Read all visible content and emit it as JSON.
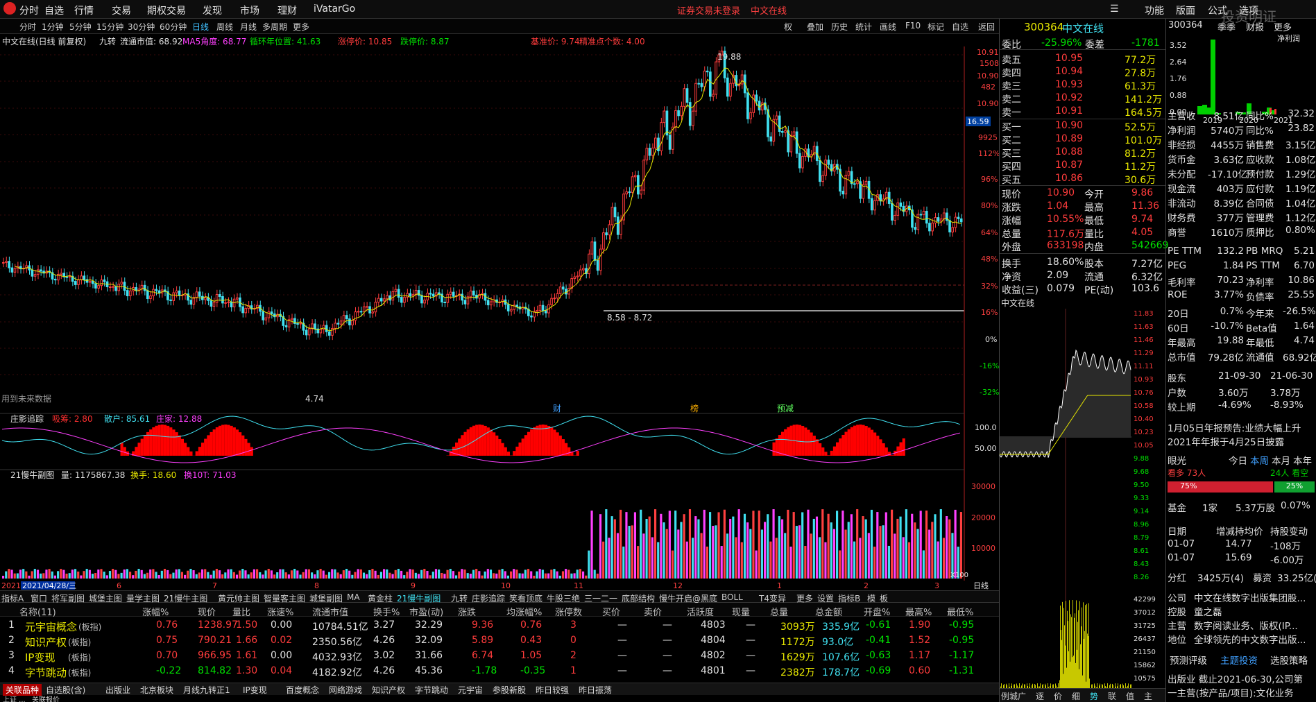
{
  "menu": {
    "items": [
      "分时",
      "自选",
      "行情",
      "交易",
      "期权交易",
      "发现",
      "市场",
      "理财",
      "iVatarGo"
    ],
    "notice_login": "证券交易未登录",
    "notice_stock": "中文在线",
    "right_items": [
      "功能",
      "版面",
      "公式",
      "选项"
    ],
    "watermark": "投资明证"
  },
  "periods": {
    "items": [
      "分时",
      "1分钟",
      "5分钟",
      "15分钟",
      "30分钟",
      "60分钟",
      "日线",
      "周线",
      "月线",
      "多周期",
      "更多"
    ],
    "active": "日线",
    "tools": [
      "权",
      "叠加",
      "历史",
      "统计",
      "画线",
      "F10",
      "标记",
      "自选",
      "返回"
    ]
  },
  "main_chart": {
    "title": "中文在线(日线 前复权)",
    "subtitle": "九转",
    "float_mv": "流通市值: 68.92",
    "ma_angle": "MA5角度: 68.77",
    "cycle": "循环年位置: 41.63",
    "limit_up": "涨停价: 10.85",
    "limit_down": "跌停价: 8.87",
    "base_price": "基准价: 9.74",
    "precision": "精准点个数: 4.00",
    "peak_label": "19.88",
    "low_label": "4.74",
    "range_label": "8.58 - 8.72",
    "bottom_note": "用到未来数据",
    "markers": [
      "财",
      "榜",
      "预减"
    ],
    "axis_labels": [
      "10.91",
      "1508",
      "10.90",
      "482",
      "10.90",
      "16.59",
      "9925",
      "112%",
      "96%",
      "80%",
      "64%",
      "48%",
      "32%",
      "16%",
      "0%",
      "-16%",
      "-32%"
    ]
  },
  "indicator1": {
    "title": "庄影追踪",
    "a": "吸筹: 2.80",
    "b": "散户: 85.61",
    "c": "庄家: 12.88",
    "axis": [
      "100.0",
      "50.00"
    ]
  },
  "indicator2": {
    "title": "21慢牛副图",
    "vol": "量: 1175867.38",
    "turnover": "换手: 18.60",
    "turnover10": "换10T: 71.03",
    "axis": [
      "30000",
      "20000",
      "10000",
      "X100"
    ]
  },
  "timeline": {
    "start": "2021",
    "date": "2021/04/28/三",
    "months": [
      "6",
      "7",
      "8",
      "9",
      "10",
      "11",
      "12",
      "1",
      "2",
      "3"
    ],
    "right": "日线"
  },
  "formula_tabs": [
    "指标A",
    "窗口",
    "将军副图",
    "城堡主图",
    "量学主图",
    "21慢牛主图",
    "黄元帅主图",
    "智量客主图",
    "城堡副图",
    "MA",
    "黄金柱",
    "21慢牛副图",
    "九转",
    "庄影追踪",
    "笑看顶底",
    "牛股三绝",
    "三一二一",
    "底部结构",
    "慢牛开启@黑底",
    "BOLL",
    "T4变异",
    "更多",
    "设置",
    "指标B",
    "模",
    "板"
  ],
  "table": {
    "headers": [
      "名称(11)",
      "涨幅%",
      "现价",
      "量比",
      "涨速%",
      "流通市值",
      "换手%",
      "市盈(动)",
      "涨跌",
      "均涨幅%",
      "涨停数",
      "买价",
      "卖价",
      "活跃度",
      "现量",
      "总量",
      "总金额",
      "开盘%",
      "最高%",
      "最低%"
    ],
    "rows": [
      {
        "idx": "1",
        "name": "元宇宙概念",
        "tag": "(板指)",
        "cells": [
          "0.76",
          "1238.97",
          "1.50",
          "0.00",
          "10784.51亿",
          "3.27",
          "32.29",
          "9.36",
          "0.76",
          "3",
          "—",
          "—",
          "4803",
          "—",
          "3093万",
          "335.9亿",
          "-0.61",
          "1.90",
          "-0.95"
        ]
      },
      {
        "idx": "2",
        "name": "知识产权",
        "tag": "(板指)",
        "cells": [
          "0.75",
          "790.21",
          "1.66",
          "0.02",
          "2350.56亿",
          "4.26",
          "32.09",
          "5.89",
          "0.43",
          "0",
          "—",
          "—",
          "4804",
          "—",
          "1172万",
          "93.0亿",
          "-0.41",
          "1.52",
          "-0.95"
        ]
      },
      {
        "idx": "3",
        "name": "IP变现",
        "tag": "(板指)",
        "cells": [
          "0.70",
          "966.95",
          "1.61",
          "0.00",
          "4032.93亿",
          "3.02",
          "31.66",
          "6.74",
          "1.05",
          "2",
          "—",
          "—",
          "4802",
          "—",
          "1629万",
          "107.6亿",
          "-0.63",
          "1.17",
          "-1.17"
        ]
      },
      {
        "idx": "4",
        "name": "字节跳动",
        "tag": "(板指)",
        "cells": [
          "-0.22",
          "814.82",
          "1.30",
          "0.04",
          "4182.92亿",
          "4.26",
          "45.36",
          "-1.78",
          "-0.35",
          "1",
          "—",
          "—",
          "4801",
          "—",
          "2382万",
          "178.7亿",
          "-0.69",
          "0.60",
          "-1.31"
        ]
      }
    ]
  },
  "bottom_tabs": [
    "关联品种",
    "自选股(含)",
    "出版业",
    "北京板块",
    "月线九转正1",
    "IP变现",
    "百度概念",
    "网络游戏",
    "知识产权",
    "字节跳动",
    "元宇宙",
    "参股新股",
    "昨日较强",
    "昨日振荡"
  ],
  "bottom_tabs2": [
    "上证 ...",
    "关联报价"
  ],
  "quote": {
    "code": "300364",
    "name": "中文在线",
    "wb_label": "委比",
    "wb": "-25.96%",
    "wc_label": "委差",
    "wc": "-1781",
    "asks": [
      {
        "l": "卖五",
        "p": "10.95",
        "v": "77.2万"
      },
      {
        "l": "卖四",
        "p": "10.94",
        "v": "27.8万"
      },
      {
        "l": "卖三",
        "p": "10.93",
        "v": "61.3万"
      },
      {
        "l": "卖二",
        "p": "10.92",
        "v": "141.2万"
      },
      {
        "l": "卖一",
        "p": "10.91",
        "v": "164.5万"
      }
    ],
    "bids": [
      {
        "l": "买一",
        "p": "10.90",
        "v": "52.5万"
      },
      {
        "l": "买二",
        "p": "10.89",
        "v": "101.0万"
      },
      {
        "l": "买三",
        "p": "10.88",
        "v": "81.2万"
      },
      {
        "l": "买四",
        "p": "10.87",
        "v": "11.2万"
      },
      {
        "l": "买五",
        "p": "10.86",
        "v": "30.6万"
      }
    ],
    "stats": [
      [
        "现价",
        "10.90",
        "今开",
        "9.86"
      ],
      [
        "涨跌",
        "1.04",
        "最高",
        "11.36"
      ],
      [
        "涨幅",
        "10.55%",
        "最低",
        "9.74"
      ],
      [
        "总量",
        "117.6万",
        "量比",
        "4.05"
      ],
      [
        "外盘",
        "633198",
        "内盘",
        "542669"
      ],
      [
        "换手",
        "18.60%",
        "股本",
        "7.27亿"
      ],
      [
        "净资",
        "2.09",
        "流通",
        "6.32亿"
      ],
      [
        "收益(三)",
        "0.079",
        "PE(动)",
        "103.6"
      ]
    ],
    "intraday_title": "中文在线",
    "intraday_axis": [
      "11.83",
      "11.63",
      "11.46",
      "11.29",
      "11.11",
      "10.93",
      "10.76",
      "10.58",
      "10.40",
      "10.23",
      "10.05",
      "9.88",
      "9.68",
      "9.50",
      "9.33",
      "9.14",
      "8.96",
      "8.79",
      "8.61",
      "8.43",
      "8.26"
    ],
    "vol_axis": [
      "42299",
      "37012",
      "31725",
      "26437",
      "21150",
      "15862",
      "10575",
      "5287"
    ],
    "bottom": [
      "例城广",
      "逐",
      "价",
      "细",
      "势",
      "联",
      "值",
      "主"
    ]
  },
  "finance": {
    "code": "300364",
    "tab": "季季",
    "tab2": "财报",
    "more": "更多",
    "chart_title": "净利润",
    "years": [
      "2019",
      "2020",
      "2021"
    ],
    "axis": [
      "3.52",
      "2.64",
      "1.76",
      "0.88",
      "0.00"
    ],
    "rows": [
      [
        "主营收",
        "8.51亿",
        "同比%",
        "32.32"
      ],
      [
        "净利润",
        "5740万",
        "同比%",
        "23.82"
      ],
      [
        "非经损",
        "4455万",
        "销售费",
        "3.15亿"
      ],
      [
        "货币金",
        "3.63亿",
        "应收款",
        "1.08亿"
      ],
      [
        "未分配",
        "-17.10亿",
        "预付款",
        "1.29亿"
      ],
      [
        "现金流",
        "403万",
        "应付款",
        "1.19亿"
      ],
      [
        "非流动",
        "8.39亿",
        "合同债",
        "1.04亿"
      ],
      [
        "财务费",
        "377万",
        "管理费",
        "1.12亿"
      ],
      [
        "商誉",
        "1610万",
        "质押比",
        "0.80%"
      ]
    ],
    "pe": [
      [
        "PE TTM",
        "132.2",
        "PB MRQ",
        "5.21"
      ],
      [
        "PEG",
        "1.84",
        "PS TTM",
        "6.70"
      ],
      [
        "毛利率",
        "70.23",
        "净利率",
        "10.86"
      ],
      [
        "ROE",
        "3.77%",
        "负债率",
        "25.55"
      ]
    ],
    "perf": [
      [
        "20日",
        "0.7%",
        "今年来",
        "-26.5%"
      ],
      [
        "60日",
        "-10.7%",
        "Beta值",
        "1.64"
      ],
      [
        "年最高",
        "19.88",
        "年最低",
        "4.74"
      ],
      [
        "总市值",
        "79.28亿",
        "流通值",
        "68.92亿"
      ]
    ],
    "holders": [
      [
        "股东",
        "21-09-30",
        "21-06-30"
      ],
      [
        "户数",
        "3.60万",
        "3.78万"
      ],
      [
        "较上期",
        "-4.69%",
        "-8.93%"
      ]
    ],
    "news1": "1月05日年报预告:业绩大幅上升",
    "news2": "2021年年报于4月25日披露",
    "eye_label": "眼光",
    "eye_tabs": [
      "今日",
      "本周",
      "本月",
      "本年"
    ],
    "eye_active": "本周",
    "bull": "看多 73人",
    "bear": "24人 看空",
    "bull_pct": "75%",
    "bear_pct": "25%",
    "fund": [
      "基金",
      "1家",
      "5.37万股",
      "0.07%"
    ],
    "holdings_hdr": [
      "日期",
      "增减持均价",
      "持股变动"
    ],
    "holdings": [
      [
        "01-07",
        "14.77",
        "-108万"
      ],
      [
        "01-07",
        "15.69",
        "-6.00万"
      ]
    ],
    "dividend": [
      "分红",
      "3425万(4)",
      "募资",
      "33.25亿(5)"
    ],
    "company": [
      [
        "公司",
        "中文在线数字出版集团股..."
      ],
      [
        "控股",
        "童之磊"
      ],
      [
        "主营",
        "数字阅读业务、版权(IP..."
      ],
      [
        "地位",
        "全球领先的中文数字出版..."
      ]
    ],
    "rating": [
      "预测评级",
      "主题投资",
      "选股策略"
    ],
    "footer1": "出版业  截止2021-06-30,公司第",
    "footer2": "一主营(按产品/项目):文化业务"
  },
  "colors": {
    "up": "#ff3c3c",
    "down": "#40e0f0",
    "ma": "#e8e800",
    "bg": "#000000"
  }
}
